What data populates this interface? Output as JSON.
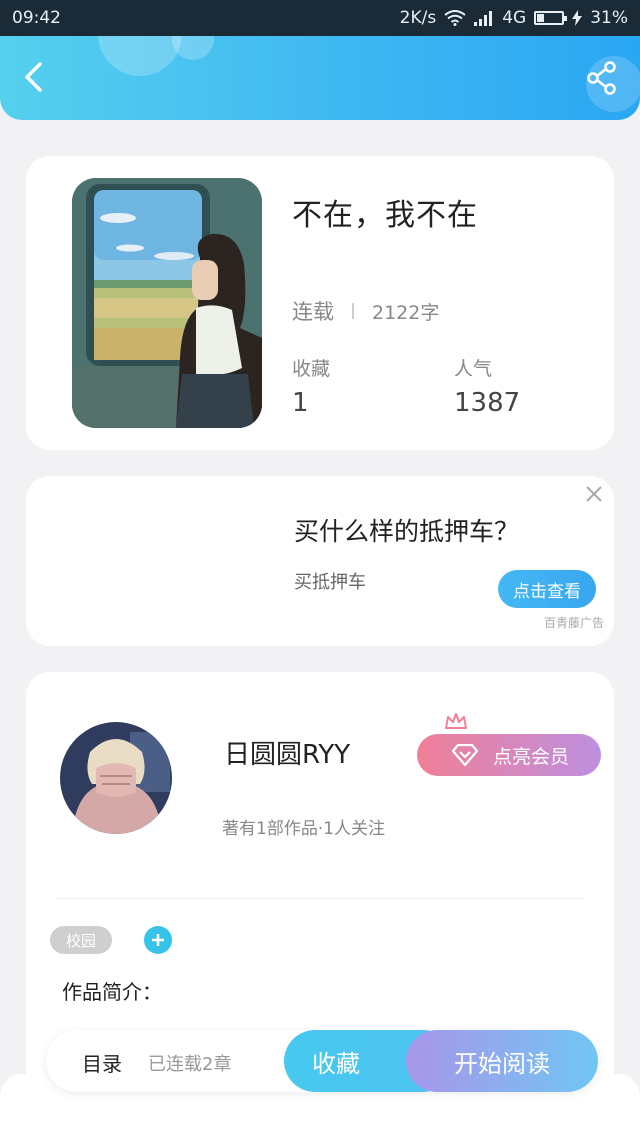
{
  "status_bar": {
    "time": "09:42",
    "speed": "2K/s",
    "network": "4G",
    "battery": "31%",
    "battery_level": 0.31
  },
  "book": {
    "title": "不在，我不在",
    "status": "连载",
    "word_count": "2122字",
    "favorites_label": "收藏",
    "favorites_value": "1",
    "popularity_label": "人气",
    "popularity_value": "1387"
  },
  "ad": {
    "title": "买什么样的抵押车？",
    "subtitle": "买抵押车",
    "button": "点击查看",
    "brand": "百青藤广告"
  },
  "author": {
    "name": "日圆圆RYY",
    "meta": "著有1部作品·1人关注",
    "vip_button": "点亮会员",
    "tag": "校园",
    "intro_label": "作品简介："
  },
  "bottom_bar": {
    "toc": "目录",
    "chapters": "已连载2章",
    "favorite": "收藏",
    "start_reading": "开始阅读"
  },
  "colors": {
    "accent": "#3db5f2",
    "vip_start": "#f07f96",
    "vip_end": "#bd8fe0"
  }
}
